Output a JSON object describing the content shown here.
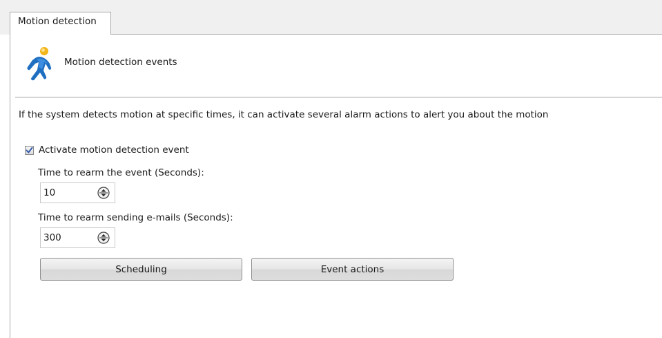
{
  "tab": {
    "label": "Motion detection"
  },
  "header": {
    "icon": "running-person-icon",
    "title": "Motion detection events"
  },
  "description": "If the system detects motion at specific times, it can activate several alarm actions to alert you about the motion",
  "activate": {
    "label": "Activate motion detection event",
    "checked": true
  },
  "rearm_event": {
    "label": "Time to rearm the event (Seconds):",
    "value": "10"
  },
  "rearm_email": {
    "label": "Time to rearm sending e-mails (Seconds):",
    "value": "300"
  },
  "buttons": {
    "scheduling": "Scheduling",
    "event_actions": "Event actions"
  }
}
